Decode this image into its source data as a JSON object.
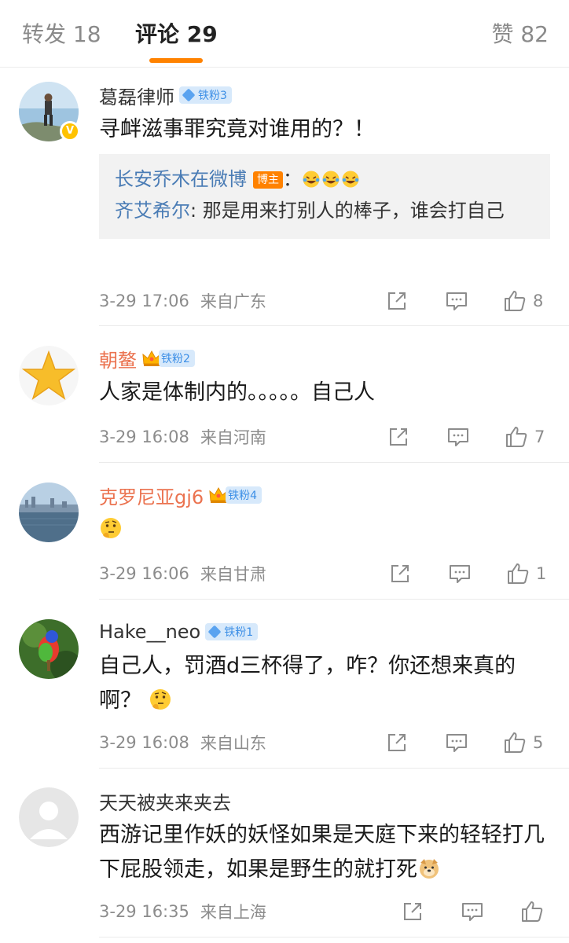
{
  "tabs": {
    "repost": "转发 18",
    "comment": "评论 29",
    "like": "赞 82"
  },
  "colors": {
    "accent": "#ff8200",
    "link": "#4a7cb5",
    "vip_name": "#eb7350",
    "fan_badge_bg": "#d7e9fb",
    "fan_badge_text": "#3d8fe6"
  },
  "comments": [
    {
      "user": "葛磊律师",
      "fan_badge": "铁粉3",
      "verified": true,
      "text": "寻衅滋事罪究竟对谁用的？！",
      "replies": {
        "line1_user": "长安乔木在微博",
        "line1_tag": "博主",
        "line1_sep": "：",
        "line2_user": "齐艾希尔",
        "line2_text": ": 那是用来打别人的棒子，谁会打自己"
      },
      "time": "3-29 17:06",
      "location": "来自广东",
      "likes": "8"
    },
    {
      "user": "朝鳌",
      "fan_badge": "铁粉2",
      "text": "人家是体制内的。。。。。自己人",
      "time": "3-29 16:08",
      "location": "来自河南",
      "likes": "7"
    },
    {
      "user": "克罗尼亚gj6",
      "fan_badge": "铁粉4",
      "text": "",
      "time": "3-29 16:06",
      "location": "来自甘肃",
      "likes": "1"
    },
    {
      "user": "Hake__neo",
      "fan_badge": "铁粉1",
      "text": "自己人，罚酒d三杯得了，咋？你还想来真的啊？",
      "time": "3-29 16:08",
      "location": "来自山东",
      "likes": "5"
    },
    {
      "user": "天天被夹来夹去",
      "text": "西游记里作妖的妖怪如果是天庭下来的轻轻打几下屁股领走，如果是野生的就打死",
      "time": "3-29 16:35",
      "location": "来自上海",
      "likes": ""
    }
  ],
  "icons": {
    "repost": "repost-icon",
    "comment": "comment-icon",
    "like": "thumbs-up-icon",
    "verified": "verified-badge-icon",
    "crown": "crown-icon",
    "fan_gem": "diamond-icon"
  }
}
